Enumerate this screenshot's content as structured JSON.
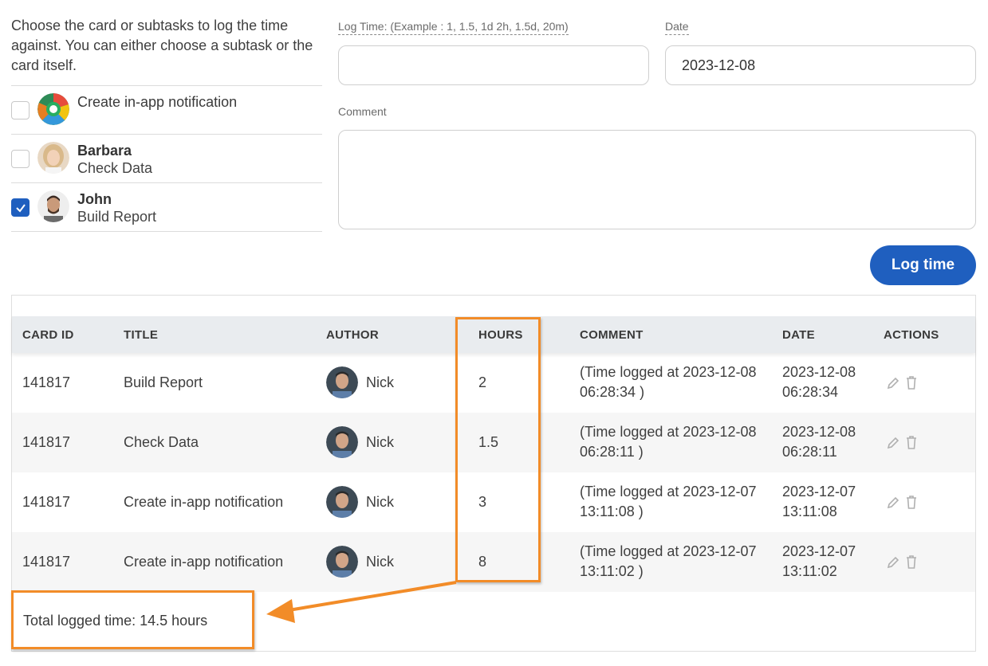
{
  "task_selector": {
    "intro": "Choose the card or subtasks to log the time against. You can either choose a subtask or the card itself.",
    "items": [
      {
        "title": "Create in-app notification",
        "checked": false
      },
      {
        "name": "Barbara",
        "subtask": "Check Data",
        "checked": false
      },
      {
        "name": "John",
        "subtask": "Build Report",
        "checked": true
      }
    ]
  },
  "form": {
    "log_time_label": "Log Time: (Example : 1, 1.5, 1d 2h, 1.5d, 20m)",
    "log_time_value": "",
    "date_label": "Date",
    "date_value": "2023-12-08",
    "comment_label": "Comment",
    "comment_value": "",
    "submit_label": "Log time"
  },
  "table": {
    "headers": [
      "CARD ID",
      "TITLE",
      "AUTHOR",
      "HOURS",
      "COMMENT",
      "DATE",
      "ACTIONS"
    ],
    "rows": [
      {
        "card_id": "141817",
        "title": "Build Report",
        "author": "Nick",
        "hours": "2",
        "comment_1": "(Time logged at 2023-12-08",
        "comment_2": "06:28:34 )",
        "date_1": "2023-12-08",
        "date_2": "06:28:34"
      },
      {
        "card_id": "141817",
        "title": "Check Data",
        "author": "Nick",
        "hours": "1.5",
        "comment_1": "(Time logged at 2023-12-08",
        "comment_2": "06:28:11 )",
        "date_1": "2023-12-08",
        "date_2": "06:28:11"
      },
      {
        "card_id": "141817",
        "title": "Create in-app notification",
        "author": "Nick",
        "hours": "3",
        "comment_1": "(Time logged at 2023-12-07",
        "comment_2": "13:11:08 )",
        "date_1": "2023-12-07",
        "date_2": "13:11:08"
      },
      {
        "card_id": "141817",
        "title": "Create in-app notification",
        "author": "Nick",
        "hours": "8",
        "comment_1": "(Time logged at 2023-12-07",
        "comment_2": "13:11:02 )",
        "date_1": "2023-12-07",
        "date_2": "13:11:02"
      }
    ],
    "total": "Total logged time: 14.5 hours"
  },
  "colors": {
    "accent": "#1f5fbf",
    "annotation": "#f28c28",
    "header_bg": "#e9ecef"
  }
}
